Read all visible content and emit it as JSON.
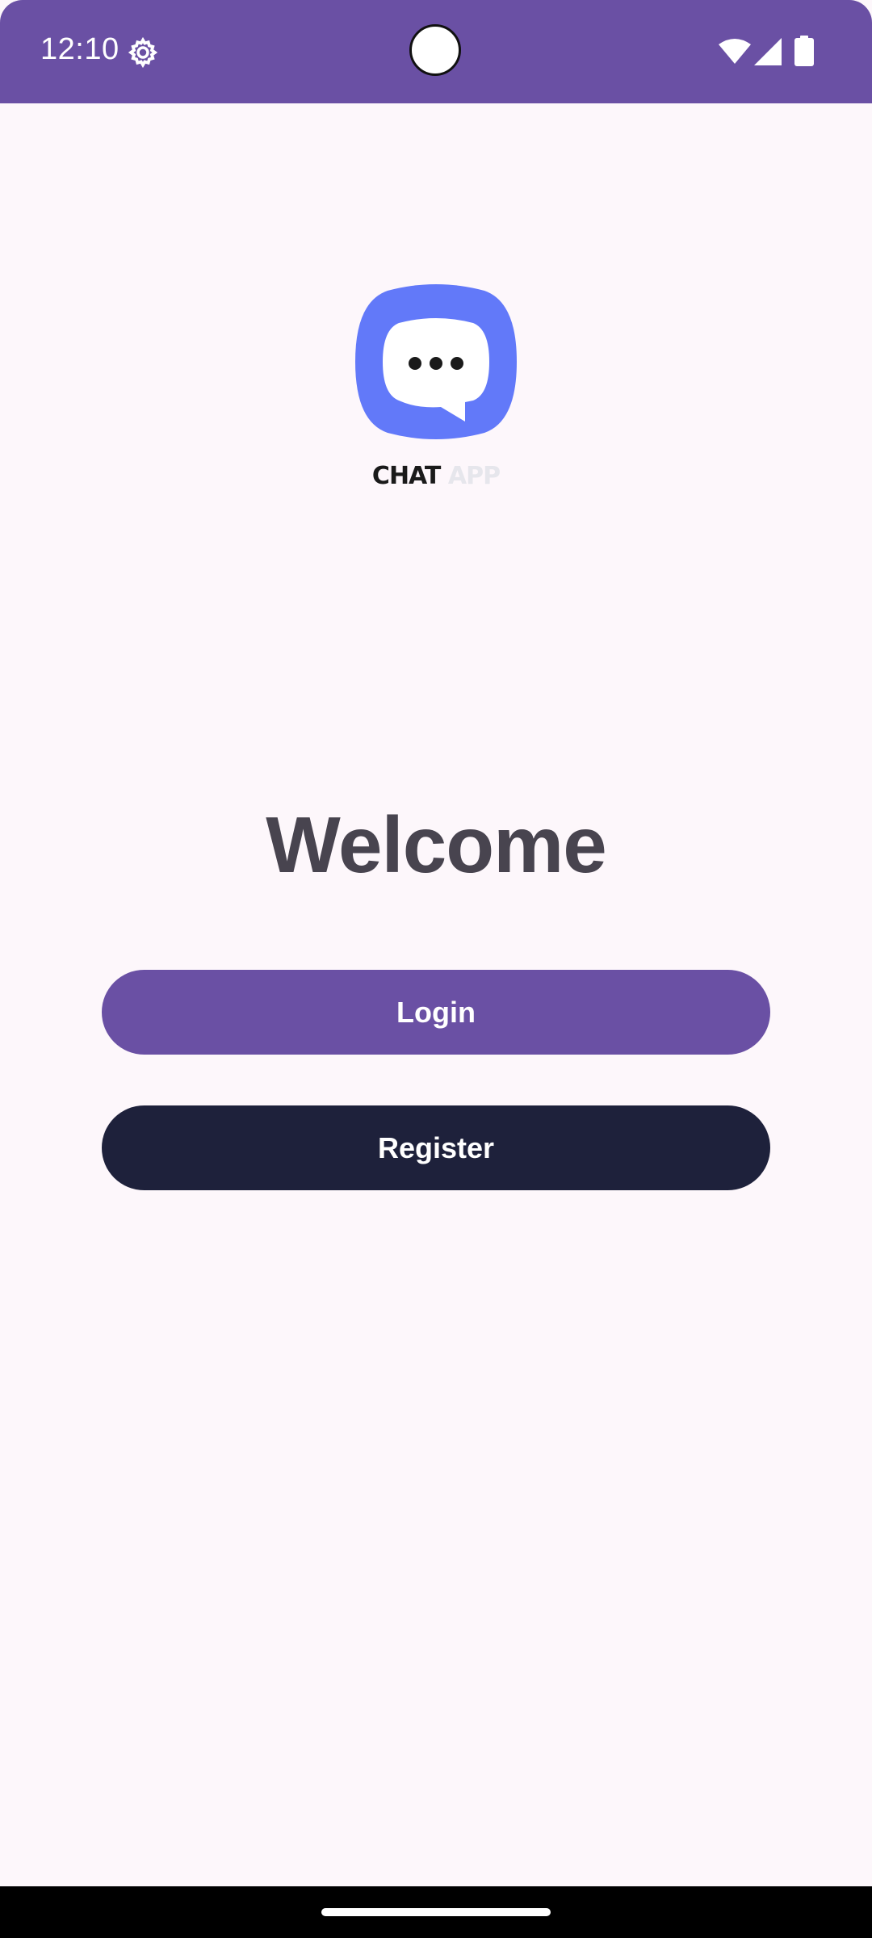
{
  "status_bar": {
    "time": "12:10",
    "background": "#6a50a4",
    "icons": [
      "settings-icon",
      "wifi-icon",
      "cellular-signal-icon",
      "battery-icon"
    ]
  },
  "logo": {
    "icon": "chat-bubble-icon",
    "brand_color": "#6279f9",
    "word1": "CHAT",
    "word2": "APP"
  },
  "welcome": {
    "title": "Welcome"
  },
  "actions": {
    "login_label": "Login",
    "login_color": "#6a50a4",
    "register_label": "Register",
    "register_color": "#1e213b"
  },
  "theme": {
    "background": "#fdf7fb",
    "title_color": "#48444f"
  }
}
